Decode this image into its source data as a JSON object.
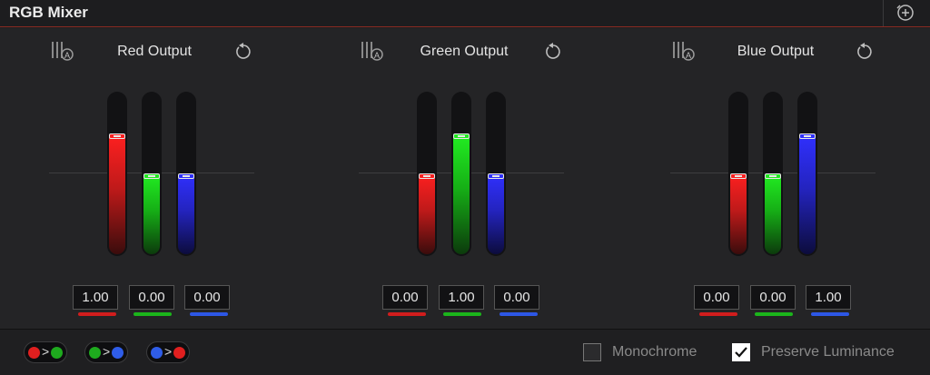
{
  "header": {
    "title": "RGB Mixer",
    "menu_icon": "plus-circle-icon"
  },
  "outputs": [
    {
      "title": "Red Output",
      "channels": [
        {
          "color": "red",
          "value": "1.00",
          "level": 1.0
        },
        {
          "color": "green",
          "value": "0.00",
          "level": 0.0
        },
        {
          "color": "blue",
          "value": "0.00",
          "level": 0.0
        }
      ]
    },
    {
      "title": "Green Output",
      "channels": [
        {
          "color": "red",
          "value": "0.00",
          "level": 0.0
        },
        {
          "color": "green",
          "value": "1.00",
          "level": 1.0
        },
        {
          "color": "blue",
          "value": "0.00",
          "level": 0.0
        }
      ]
    },
    {
      "title": "Blue Output",
      "channels": [
        {
          "color": "red",
          "value": "0.00",
          "level": 0.0
        },
        {
          "color": "green",
          "value": "0.00",
          "level": 0.0
        },
        {
          "color": "blue",
          "value": "1.00",
          "level": 1.0
        }
      ]
    }
  ],
  "swap_buttons": [
    {
      "from": "#e01f1f",
      "to": "#1eaa1e"
    },
    {
      "from": "#1eaa1e",
      "to": "#2f5de8"
    },
    {
      "from": "#2f5de8",
      "to": "#e01f1f"
    }
  ],
  "options": {
    "monochrome": {
      "label": "Monochrome",
      "checked": false
    },
    "preserve_luminance": {
      "label": "Preserve Luminance",
      "checked": true
    }
  },
  "colors": {
    "red": "#d11d1d",
    "green": "#1bb51b",
    "blue": "#2d57e6",
    "accent_border": "#8a2a22"
  }
}
